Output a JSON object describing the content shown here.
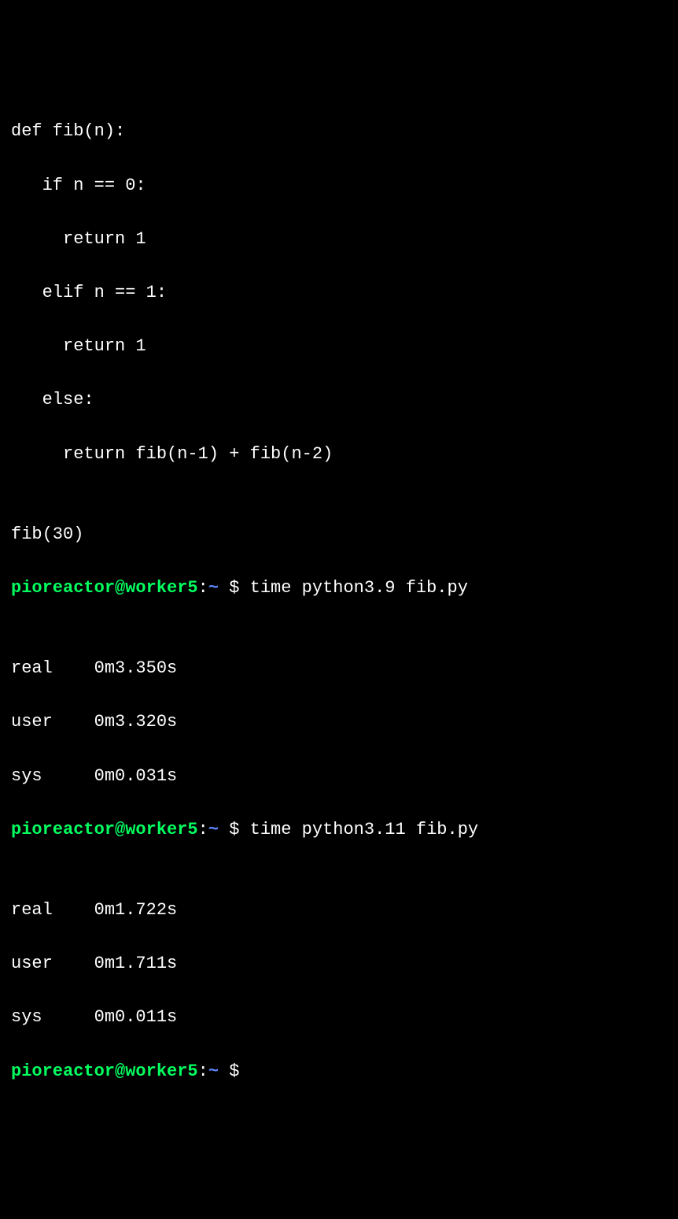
{
  "code": {
    "l1": "def fib(n):",
    "l2": "   if n == 0:",
    "l3": "     return 1",
    "l4": "   elif n == 1:",
    "l5": "     return 1",
    "l6": "   else:",
    "l7": "     return fib(n-1) + fib(n-2)",
    "l8": "",
    "l9": "fib(30)"
  },
  "prompt": {
    "user_host": "pioreactor@worker5",
    "colon": ":",
    "path": "~ ",
    "dollar": "$ "
  },
  "run1": {
    "command": "time python3.9 fib.py",
    "real": "real    0m3.350s",
    "user": "user    0m3.320s",
    "sys": "sys     0m0.031s"
  },
  "run2": {
    "command": "time python3.11 fib.py",
    "real": "real    0m1.722s",
    "user": "user    0m1.711s",
    "sys": "sys     0m0.011s"
  },
  "empty": ""
}
